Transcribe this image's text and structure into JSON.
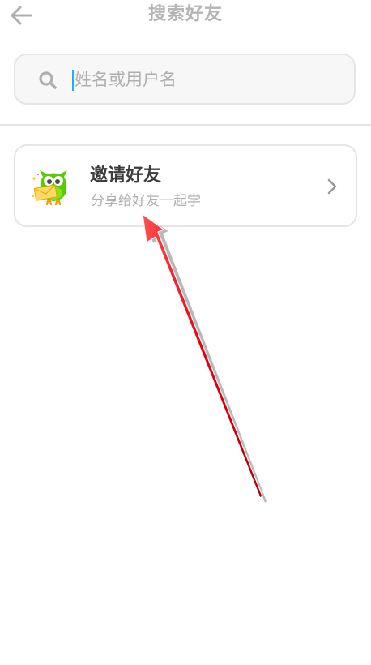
{
  "header": {
    "title": "搜索好友"
  },
  "search": {
    "placeholder": "姓名或用户名",
    "value": ""
  },
  "invite": {
    "title": "邀请好友",
    "subtitle": "分享给好友一起学"
  },
  "icons": {
    "back": "arrow-left-icon",
    "search": "search-icon",
    "mascot": "owl-icon",
    "chevron": "chevron-right-icon"
  },
  "colors": {
    "title": "#b4b4b4",
    "caret": "#1cb0f6",
    "border": "#e5e5e5",
    "owl_green": "#58cc02",
    "annotation_red": "#e8000f"
  }
}
